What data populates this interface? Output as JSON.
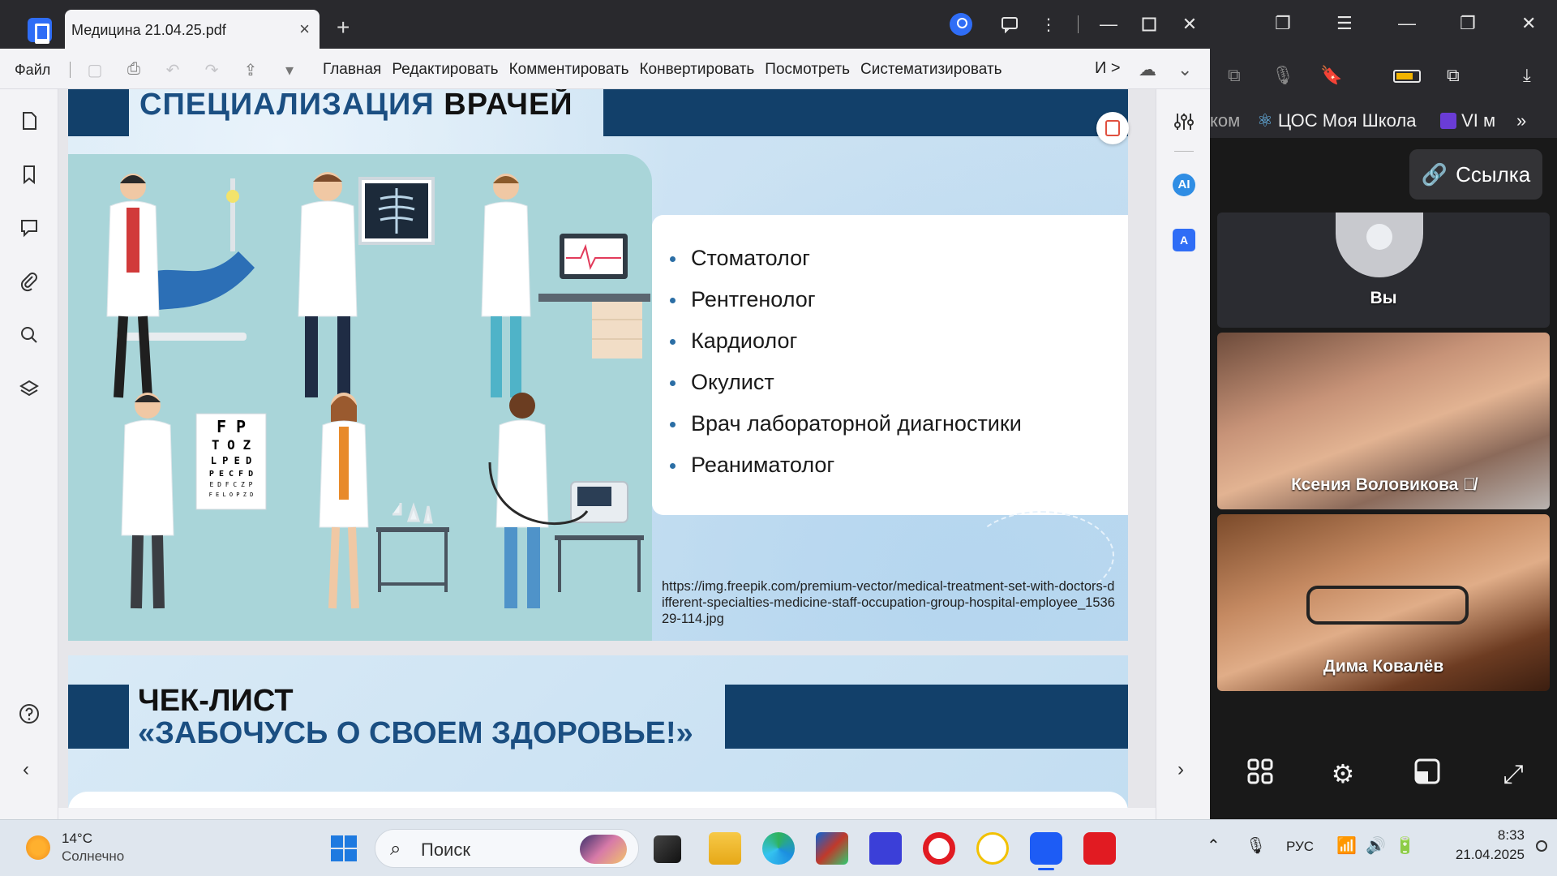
{
  "pdf_app": {
    "tab_title": "Медицина 21.04.25.pdf",
    "tab_close": "×",
    "new_tab": "+",
    "menu_file": "Файл",
    "menus": [
      "Главная",
      "Редактировать",
      "Комментировать",
      "Конвертировать",
      "Посмотреть",
      "Систематизировать"
    ],
    "menu_more": "И >"
  },
  "page1": {
    "heading_part1": "СПЕЦИАЛИЗАЦИЯ",
    "heading_part2": "ВРАЧЕЙ",
    "list": [
      "Стоматолог",
      "Рентгенолог",
      "Кардиолог",
      "Окулист",
      "Врач лабораторной диагностики",
      "Реаниматолог"
    ],
    "source_url": "https://img.freepik.com/premium-vector/medical-treatment-set-with-doctors-different-specialties-medicine-staff-occupation-group-hospital-employee_153629-114.jpg"
  },
  "page2": {
    "title_line1": "ЧЕК-ЛИСТ",
    "title_line2": "«ЗАБОЧУСЬ О СВОЕМ ЗДОРОВЬЕ!»"
  },
  "right_rail": {
    "ai_label": "AI"
  },
  "browser": {
    "bookmark_cut": "ком",
    "bookmark_1": "ЦОС Моя Школа",
    "bookmark_2": "VI м",
    "more": "»"
  },
  "meeting": {
    "link_button": "Ссылка",
    "self_name": "Вы",
    "participants": [
      {
        "name": "Ксения Воловикова"
      },
      {
        "name": "Дима Ковалёв"
      }
    ]
  },
  "taskbar": {
    "temperature": "14°C",
    "condition": "Солнечно",
    "search_placeholder": "Поиск",
    "language": "РУС",
    "time": "8:33",
    "date": "21.04.2025"
  },
  "colors": {
    "slide_band": "#12406a",
    "heading_blue": "#1b4f82",
    "accent": "#2f6df6"
  }
}
